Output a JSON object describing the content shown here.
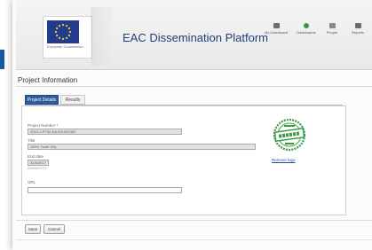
{
  "header": {
    "logo_text": "European Commission",
    "app_title": "EAC Dissemination Platform",
    "nav": [
      {
        "label": "My Dashboard",
        "icon": "dashboard-icon"
      },
      {
        "label": "Dashboards",
        "icon": "dashboards-icon"
      },
      {
        "label": "People",
        "icon": "people-icon"
      },
      {
        "label": "Reports",
        "icon": "reports-icon"
      }
    ]
  },
  "page": {
    "title": "Project Information"
  },
  "tabs": [
    {
      "label": "Project Details",
      "active": true
    },
    {
      "label": "Results",
      "active": false
    }
  ],
  "form": {
    "project_number": {
      "label": "Project Number *",
      "value": "2015-1-PT02-KA105-002302"
    },
    "title": {
      "label": "Title",
      "value": "100% Youth City"
    },
    "end_date": {
      "label": "End date",
      "value": "31/8/2017",
      "hint": "DD/MM/YYYY"
    },
    "url": {
      "label": "URL",
      "value": ""
    }
  },
  "stamp": {
    "label": "Success Story stamp",
    "remove_link": "Remove logo"
  },
  "footer": {
    "save_label": "Save",
    "cancel_label": "Cancel"
  },
  "colors": {
    "accent": "#1a56a6",
    "tab_active": "#2f5c9e",
    "title_text": "#1f3f7a",
    "stamp_green": "#3c9a45"
  }
}
